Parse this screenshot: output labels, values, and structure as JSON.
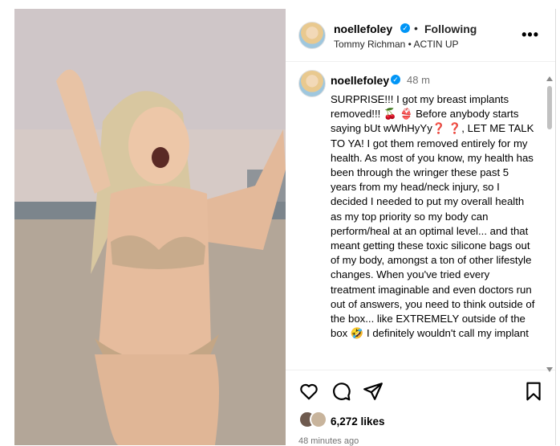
{
  "post": {
    "username": "noellefoley",
    "follow_status": "Following",
    "audio": "Tommy Richman • ACTIN UP",
    "time_short": "48 m",
    "caption": "SURPRISE!!! I got my breast implants removed!!! 🍒 👙 Before anybody starts saying bUt wWhHyYy❓ ❓, LET ME TALK TO YA! I got them removed entirely for my health. As most of you know, my health has been through the wringer these past 5 years from my head/neck injury, so I decided I needed to put my overall health as my top priority so my body can perform/heal at an optimal level... and that meant getting these toxic silicone bags out of my body, amongst a ton of other lifestyle changes. When you've tried every treatment imaginable and even doctors run out of answers, you need to think outside of the box... like EXTREMELY outside of the box 🤣 I definitely wouldn't call my implant",
    "likes": "6,272 likes",
    "time_ago": "48 minutes ago",
    "more": "•••",
    "dot": "•"
  },
  "icons": {
    "verified": "verified-badge",
    "heart": "heart-icon",
    "comment": "comment-icon",
    "share": "share-icon",
    "save": "bookmark-icon",
    "more": "more-options-icon"
  },
  "colors": {
    "verified": "#0095f6",
    "accent": "#0095f6"
  }
}
